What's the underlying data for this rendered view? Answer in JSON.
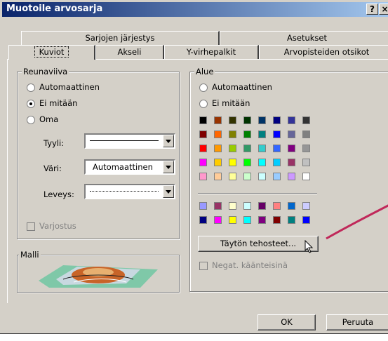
{
  "window": {
    "title": "Muotoile arvosarja",
    "help_btn": "?",
    "close_btn": "×"
  },
  "tabs_back": [
    "Sarjojen järjestys",
    "Asetukset"
  ],
  "tabs_front": [
    "Kuviot",
    "Akseli",
    "Y-virhepalkit",
    "Arvopisteiden otsikot"
  ],
  "border_group": {
    "title": "Reunaviiva",
    "options": [
      "Automaattinen",
      "Ei mitään",
      "Oma"
    ],
    "selected": "Ei mitään",
    "style_label": "Tyyli:",
    "color_label": "Väri:",
    "color_value": "Automaattinen",
    "weight_label": "Leveys:"
  },
  "shadow_label": "Varjostus",
  "sample_label": "Malli",
  "area_group": {
    "title": "Alue",
    "options": [
      "Automaattinen",
      "Ei mitään"
    ],
    "selected": "Ei mitään",
    "palette_main": [
      [
        "#000000",
        "#993300",
        "#333300",
        "#003300",
        "#003366",
        "#000080",
        "#333399",
        "#333333"
      ],
      [
        "#800000",
        "#FF6600",
        "#808000",
        "#008000",
        "#008080",
        "#0000FF",
        "#666699",
        "#808080"
      ],
      [
        "#FF0000",
        "#FF9900",
        "#99CC00",
        "#339966",
        "#33CCCC",
        "#3366FF",
        "#800080",
        "#969696"
      ],
      [
        "#FF00FF",
        "#FFCC00",
        "#FFFF00",
        "#00FF00",
        "#00FFFF",
        "#00CCFF",
        "#993366",
        "#C0C0C0"
      ],
      [
        "#FF99CC",
        "#FFCC99",
        "#FFFF99",
        "#CCFFCC",
        "#CCFFFF",
        "#99CCFF",
        "#CC99FF",
        "#FFFFFF"
      ]
    ],
    "palette_chart": [
      [
        "#9999FF",
        "#993366",
        "#FFFFCC",
        "#CCFFFF",
        "#660066",
        "#FF8080",
        "#0066CC",
        "#CCCCFF"
      ],
      [
        "#000080",
        "#FF00FF",
        "#FFFF00",
        "#00FFFF",
        "#800080",
        "#800000",
        "#008080",
        "#0000FF"
      ]
    ],
    "fill_effects_btn": "Täytön tehosteet...",
    "invert_label": "Negat. käänteisinä"
  },
  "ok_btn": "OK",
  "cancel_btn": "Peruuta"
}
